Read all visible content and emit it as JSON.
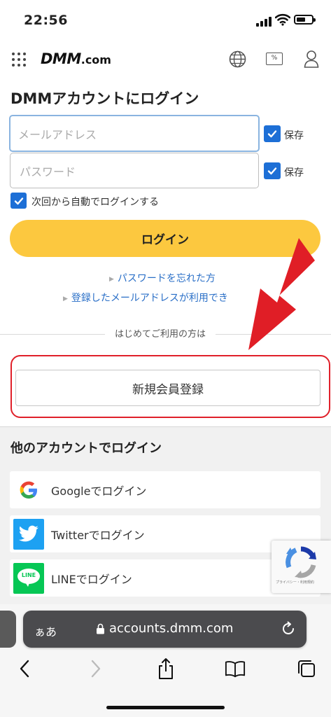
{
  "status_bar": {
    "time": "22:56"
  },
  "header": {
    "logo_main": "DMM",
    "logo_suffix": ".com",
    "points_badge": "%"
  },
  "login_form": {
    "title": "DMMアカウントにログイン",
    "email_placeholder": "メールアドレス",
    "password_placeholder": "パスワード",
    "save_email_label": "保存",
    "save_password_label": "保存",
    "auto_login_label": "次回から自動でログインする",
    "login_button": "ログイン",
    "forgot_password_link": "パスワードを忘れた方",
    "registered_email_link": "登録したメールアドレスが利用でき"
  },
  "first_time": {
    "divider_label": "はじめてご利用の方は",
    "register_button": "新規会員登録"
  },
  "other_accounts": {
    "title": "他のアカウントでログイン",
    "items": [
      {
        "label": "Googleでログイン",
        "icon": "google-icon"
      },
      {
        "label": "Twitterでログイン",
        "icon": "twitter-icon"
      },
      {
        "label": "LINEでログイン",
        "icon": "line-icon"
      }
    ],
    "line_icon_text": "LINE"
  },
  "recaptcha": {
    "footer": "プライバシー・利用規約"
  },
  "browser": {
    "aa_label": "ぁあ",
    "url": "accounts.dmm.com"
  },
  "colors": {
    "accent_yellow": "#fcc83f",
    "checkbox_blue": "#1d6fd6",
    "link_blue": "#2a6fc7",
    "highlight_red": "#e0202a",
    "twitter_blue": "#1da1f2",
    "line_green": "#06c755"
  }
}
